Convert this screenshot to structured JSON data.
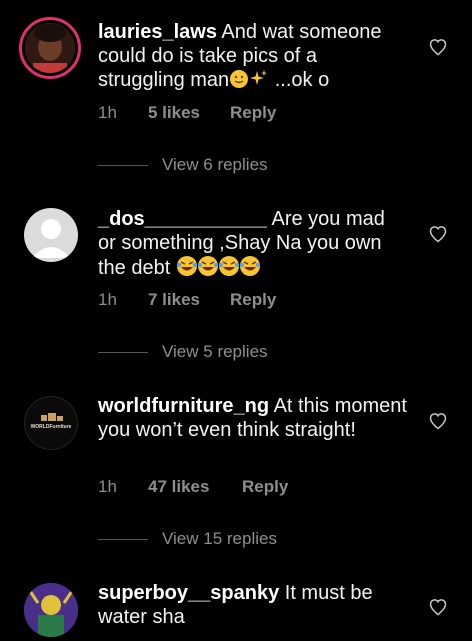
{
  "comments": [
    {
      "username": "lauries_laws",
      "text": "And wat someone could do is take pics of a struggling man",
      "text_tail": " ...ok o",
      "time": "1h",
      "likes": "5 likes",
      "reply": "Reply",
      "view_replies": "View 6 replies"
    },
    {
      "username": "_dos___________",
      "text": "Are you mad or something ,Shay Na you own the debt",
      "time": "1h",
      "likes": "7 likes",
      "reply": "Reply",
      "view_replies": "View 5 replies"
    },
    {
      "username": "worldfurniture_ng",
      "text": "At this moment you won’t even think straight!",
      "time": "1h",
      "likes": "47 likes",
      "reply": "Reply",
      "view_replies": "View 15 replies",
      "avatar_logo_text": "WORLDFurniture"
    },
    {
      "username": "superboy__spanky",
      "text": "It must be water sha"
    }
  ],
  "colors": {
    "background": "#000000",
    "meta_text": "#8e8e8e",
    "story_ring": "#e1306c"
  }
}
